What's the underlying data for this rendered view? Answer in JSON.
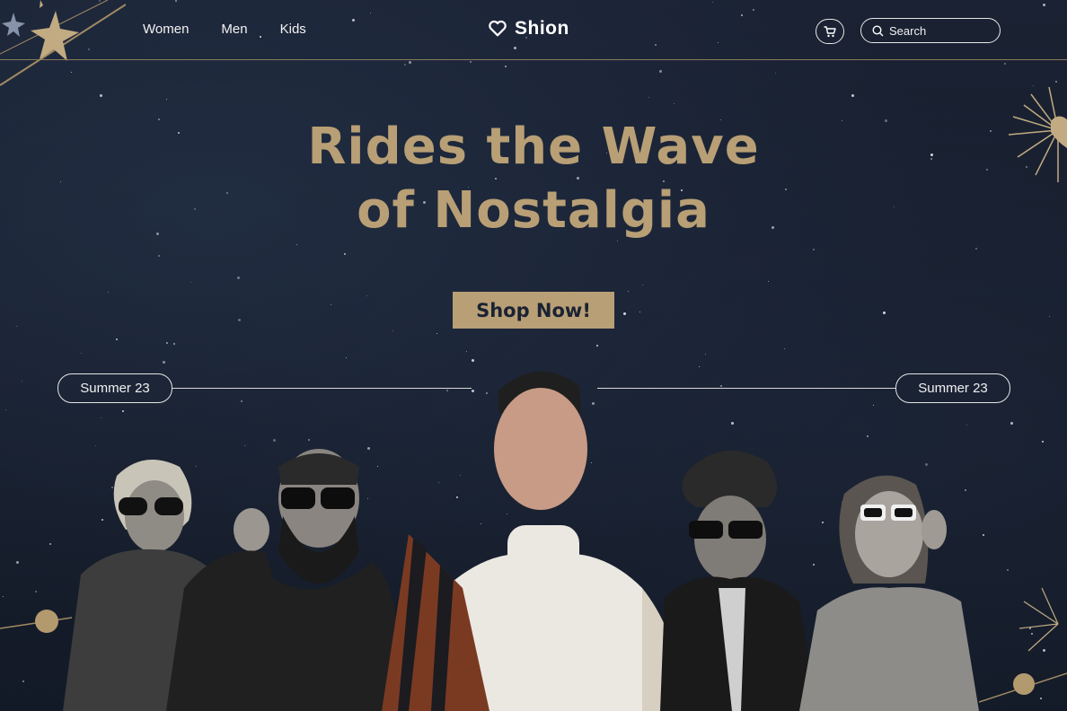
{
  "nav": {
    "items": [
      {
        "label": "Women"
      },
      {
        "label": "Men"
      },
      {
        "label": "Kids"
      }
    ]
  },
  "brand": {
    "name": "Shion",
    "icon": "heart-outline-icon"
  },
  "header": {
    "cart_icon": "cart-icon",
    "search_placeholder": "Search",
    "search_icon": "search-icon"
  },
  "hero": {
    "headline_line1": "Rides the Wave",
    "headline_line2": "of Nostalgia",
    "cta_label": "Shop Now!"
  },
  "collection": {
    "left_label": "Summer 23",
    "right_label": "Summer 23"
  },
  "colors": {
    "accent": "#b89f75",
    "background": "#182030",
    "rule": "#8a7a5a"
  }
}
